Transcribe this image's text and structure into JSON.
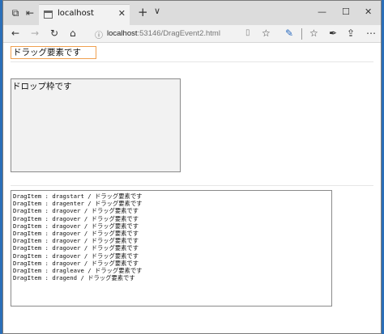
{
  "browser": {
    "tab_title": "localhost",
    "new_tab": "+",
    "tab_list": "∨",
    "url_host": "localhost",
    "url_rest": ":53146/DragEvent2.html"
  },
  "page": {
    "drag_label": "ドラッグ要素です",
    "drop_label": "ドロップ枠です",
    "log_lines": [
      "DragItem : dragstart / ドラッグ要素です",
      "DragItem : dragenter / ドラッグ要素です",
      "DragItem : dragover / ドラッグ要素です",
      "DragItem : dragover / ドラッグ要素です",
      "DragItem : dragover / ドラッグ要素です",
      "DragItem : dragover / ドラッグ要素です",
      "DragItem : dragover / ドラッグ要素です",
      "DragItem : dragover / ドラッグ要素です",
      "DragItem : dragover / ドラッグ要素です",
      "DragItem : dragover / ドラッグ要素です",
      "DragItem : dragleave / ドラッグ要素です",
      "DragItem : dragend / ドラッグ要素です"
    ]
  }
}
